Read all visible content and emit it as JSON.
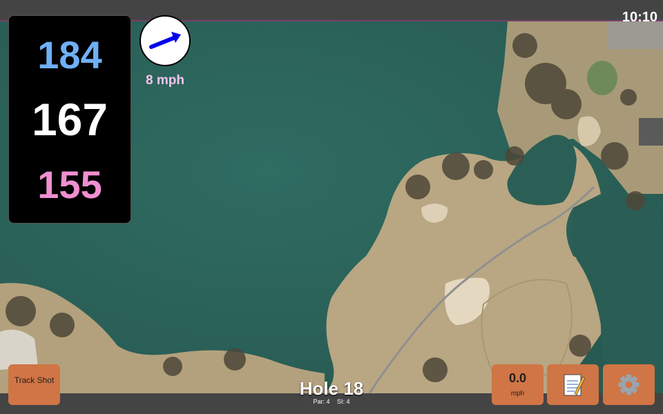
{
  "status_bar": {
    "clock": "10:10"
  },
  "yardages": {
    "back": "184",
    "middle": "167",
    "front": "155"
  },
  "wind": {
    "speed_label": "8 mph",
    "icon": "wind-direction-arrow-icon",
    "arrow_color": "#0000ee"
  },
  "hole": {
    "title": "Hole 18",
    "par": "Par: 4",
    "stroke_index": "SI: 4"
  },
  "buttons": {
    "track_shot": "Track Shot",
    "speed_value": "0.0",
    "speed_unit": "mph",
    "notes_icon": "notepad-icon",
    "settings_icon": "gear-icon"
  },
  "colors": {
    "back_yardage": "#6fb0f6",
    "middle_yardage": "#ffffff",
    "front_yardage": "#f08fd0",
    "button_bg": "#d07545",
    "water": "#2f6a60",
    "fairway": "#b9a683"
  }
}
